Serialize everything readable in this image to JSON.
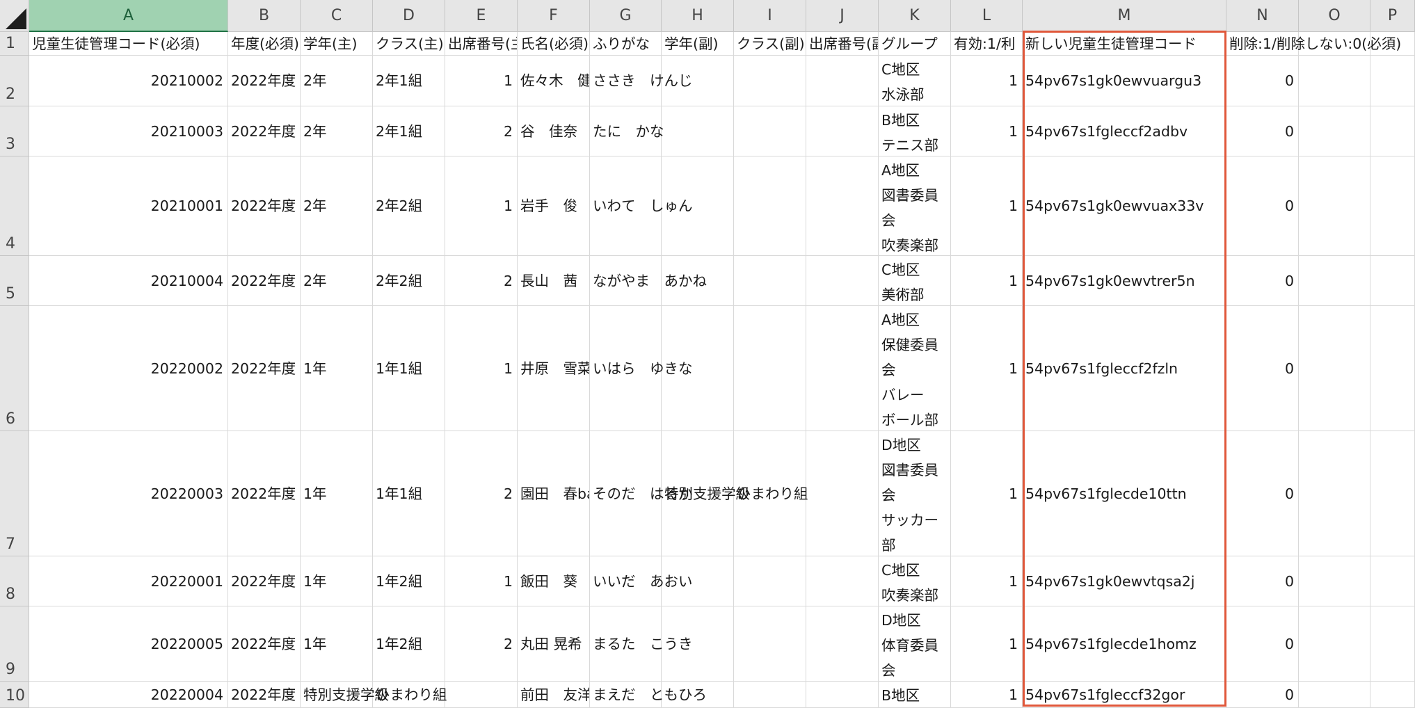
{
  "column_headers": [
    "A",
    "B",
    "C",
    "D",
    "E",
    "F",
    "G",
    "H",
    "I",
    "J",
    "K",
    "L",
    "M",
    "N",
    "O",
    "P"
  ],
  "row_headers": [
    "1",
    "2",
    "3",
    "4",
    "5",
    "6",
    "7",
    "8",
    "9",
    "10"
  ],
  "header_row": {
    "A": "児童生徒管理コード(必須)",
    "B": "年度(必須)",
    "C": "学年(主)",
    "D": "クラス(主)",
    "E": "出席番号(主)",
    "F": "氏名(必須)",
    "G": "ふりがな",
    "H": "学年(副)",
    "I": "クラス(副)",
    "J": "出席番号(副)",
    "K": "グループ",
    "L": "有効:1/利",
    "M": "新しい児童生徒管理コード",
    "N": "削除:1/削除しない:0(必須)"
  },
  "rows": [
    {
      "A": "20210002",
      "B": "2022年度",
      "C": "2年",
      "D": "2年1組",
      "E": "1",
      "F": "佐々木　健",
      "G": "ささき　けんじ",
      "H": "",
      "I": "",
      "J": "",
      "K": [
        "C地区",
        "水泳部"
      ],
      "L": "1",
      "M": "54pv67s1gk0ewvuargu3",
      "N": "0"
    },
    {
      "A": "20210003",
      "B": "2022年度",
      "C": "2年",
      "D": "2年1組",
      "E": "2",
      "F": "谷　佳奈",
      "G": "たに　かな",
      "H": "",
      "I": "",
      "J": "",
      "K": [
        "B地区",
        "テニス部"
      ],
      "L": "1",
      "M": "54pv67s1fgleccf2adbv",
      "N": "0"
    },
    {
      "A": "20210001",
      "B": "2022年度",
      "C": "2年",
      "D": "2年2組",
      "E": "1",
      "F": "岩手　俊",
      "G": "いわて　しゅん",
      "H": "",
      "I": "",
      "J": "",
      "K": [
        "A地区",
        "図書委員",
        "会",
        "吹奏楽部"
      ],
      "L": "1",
      "M": "54pv67s1gk0ewvuax33v",
      "N": "0"
    },
    {
      "A": "20210004",
      "B": "2022年度",
      "C": "2年",
      "D": "2年2組",
      "E": "2",
      "F": "長山　茜",
      "G": "ながやま　あかね",
      "H": "",
      "I": "",
      "J": "",
      "K": [
        "C地区",
        "美術部"
      ],
      "L": "1",
      "M": "54pv67s1gk0ewvtrer5n",
      "N": "0"
    },
    {
      "A": "20220002",
      "B": "2022年度",
      "C": "1年",
      "D": "1年1組",
      "E": "1",
      "F": "井原　雪菜",
      "G": "いはら　ゆきな",
      "H": "",
      "I": "",
      "J": "",
      "K": [
        "A地区",
        "保健委員",
        "会",
        "バレー",
        "ボール部"
      ],
      "L": "1",
      "M": "54pv67s1fgleccf2fzln",
      "N": "0"
    },
    {
      "A": "20220003",
      "B": "2022年度",
      "C": "1年",
      "D": "1年1組",
      "E": "2",
      "F": "園田　春based",
      "G": "そのだ　はるか",
      "H": "特別支援学級",
      "I": "ひまわり組",
      "J": "",
      "K": [
        "D地区",
        "図書委員",
        "会",
        "サッカー",
        "部"
      ],
      "L": "1",
      "M": "54pv67s1fglecde10ttn",
      "N": "0"
    },
    {
      "A": "20220001",
      "B": "2022年度",
      "C": "1年",
      "D": "1年2組",
      "E": "1",
      "F": "飯田　葵",
      "G": "いいだ　あおい",
      "H": "",
      "I": "",
      "J": "",
      "K": [
        "C地区",
        "吹奏楽部"
      ],
      "L": "1",
      "M": "54pv67s1gk0ewvtqsa2j",
      "N": "0"
    },
    {
      "A": "20220005",
      "B": "2022年度",
      "C": "1年",
      "D": "1年2組",
      "E": "2",
      "F": "丸田 晃希",
      "G": "まるた　こうき",
      "H": "",
      "I": "",
      "J": "",
      "K": [
        "D地区",
        "体育委員",
        "会"
      ],
      "L": "1",
      "M": "54pv67s1fglecde1homz",
      "N": "0"
    },
    {
      "A": "20220004",
      "B": "2022年度",
      "C": "特別支援学級",
      "D": "ひまわり組",
      "E": "",
      "F": "前田　友洋",
      "G": "まえだ　ともひろ",
      "H": "",
      "I": "",
      "J": "",
      "K": [
        "B地区"
      ],
      "L": "1",
      "M": "54pv67s1fgleccf32gor",
      "N": "0"
    }
  ],
  "selected_column": "A",
  "highlight_column": "M",
  "colors": {
    "highlight_border": "#e0573a",
    "selected_header": "#a0d2b1"
  }
}
